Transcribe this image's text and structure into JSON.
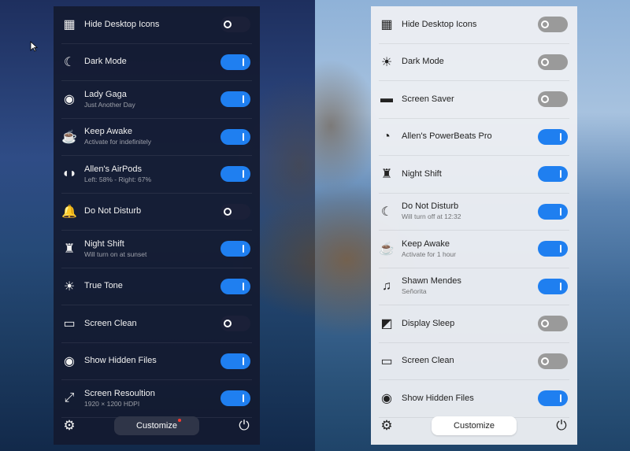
{
  "left_panel": {
    "items": [
      {
        "label": "Hide Desktop Icons",
        "sub": "",
        "on": false,
        "icon": "grid-icon"
      },
      {
        "label": "Dark Mode",
        "sub": "",
        "on": true,
        "icon": "moon-icon"
      },
      {
        "label": "Lady Gaga",
        "sub": "Just Another Day",
        "on": true,
        "icon": "spotify-icon"
      },
      {
        "label": "Keep Awake",
        "sub": "Activate for indefinitely",
        "on": true,
        "icon": "coffee-icon"
      },
      {
        "label": "Allen's AirPods",
        "sub": "Left: 58% - Right: 67%",
        "on": true,
        "icon": "airpods-icon"
      },
      {
        "label": "Do Not Disturb",
        "sub": "",
        "on": false,
        "icon": "bell-icon"
      },
      {
        "label": "Night Shift",
        "sub": "Will turn on at sunset",
        "on": true,
        "icon": "lamp-icon"
      },
      {
        "label": "True Tone",
        "sub": "",
        "on": true,
        "icon": "sun-icon"
      },
      {
        "label": "Screen Clean",
        "sub": "",
        "on": false,
        "icon": "laptop-clean-icon"
      },
      {
        "label": "Show Hidden Files",
        "sub": "",
        "on": true,
        "icon": "eye-icon"
      },
      {
        "label": "Screen Resoultion",
        "sub": "1920 × 1200 HDPI",
        "on": true,
        "icon": "resolution-icon"
      }
    ],
    "customize_label": "Customize"
  },
  "right_panel": {
    "items": [
      {
        "label": "Hide Desktop Icons",
        "sub": "",
        "on": false,
        "icon": "grid-icon"
      },
      {
        "label": "Dark Mode",
        "sub": "",
        "on": false,
        "icon": "sun-icon"
      },
      {
        "label": "Screen Saver",
        "sub": "",
        "on": false,
        "icon": "screen-saver-icon"
      },
      {
        "label": "Allen's PowerBeats Pro",
        "sub": "",
        "on": true,
        "icon": "earbuds-icon"
      },
      {
        "label": "Night Shift",
        "sub": "",
        "on": true,
        "icon": "lamp-icon"
      },
      {
        "label": "Do Not Disturb",
        "sub": "Will turn off at 12:32",
        "on": true,
        "icon": "moon-icon"
      },
      {
        "label": "Keep Awake",
        "sub": "Activate for 1 hour",
        "on": true,
        "icon": "coffee-icon"
      },
      {
        "label": "Shawn Mendes",
        "sub": "Señorita",
        "on": true,
        "icon": "music-icon"
      },
      {
        "label": "Display Sleep",
        "sub": "",
        "on": false,
        "icon": "display-sleep-icon"
      },
      {
        "label": "Screen Clean",
        "sub": "",
        "on": false,
        "icon": "laptop-clean-icon"
      },
      {
        "label": "Show Hidden Files",
        "sub": "",
        "on": true,
        "icon": "eye-icon"
      }
    ],
    "customize_label": "Customize"
  },
  "colors": {
    "toggle_on": "#1f7ff0",
    "dark_panel": "#141a30",
    "light_panel": "#eceef2"
  }
}
